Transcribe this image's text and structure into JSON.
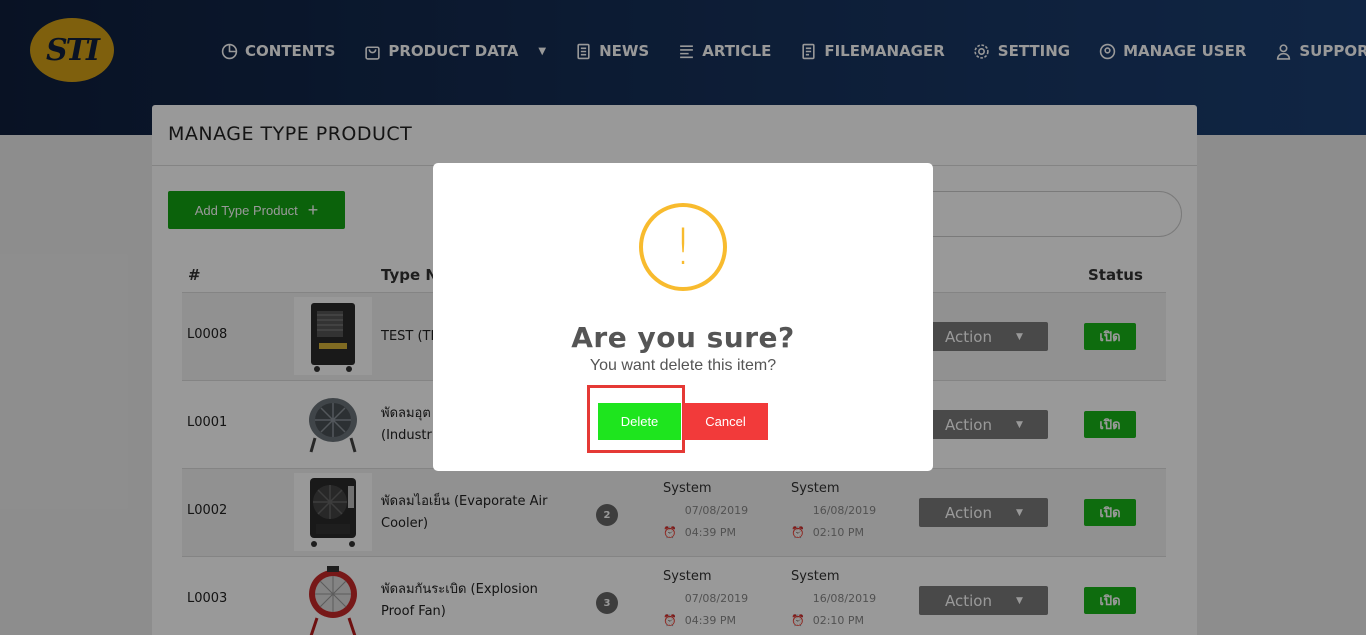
{
  "brand": {
    "logo_text": "STI"
  },
  "nav": [
    {
      "label": "CONTENTS",
      "icon": "pie-chart-icon"
    },
    {
      "label": "PRODUCT DATA",
      "icon": "bag-icon"
    },
    {
      "label": "NEWS",
      "icon": "newspaper-icon"
    },
    {
      "label": "ARTICLE",
      "icon": "text-lines-icon"
    },
    {
      "label": "FILEMANAGER",
      "icon": "document-icon"
    },
    {
      "label": "SETTING",
      "icon": "gear-icon"
    },
    {
      "label": "MANAGE USER",
      "icon": "user-circle-icon"
    },
    {
      "label": "SUPPORT",
      "icon": "person-icon"
    }
  ],
  "page": {
    "title": "MANAGE TYPE PRODUCT",
    "add_button": "Add Type Product",
    "add_icon": "+"
  },
  "table": {
    "headers": {
      "code": "#",
      "type_name": "Type N",
      "status": "Status"
    },
    "rows": [
      {
        "code": "L0008",
        "name": "TEST (TE",
        "count": "",
        "created_by": "",
        "created_at": "",
        "updated_by": "",
        "updated_at": "",
        "action": "Action",
        "status": "เปิด"
      },
      {
        "code": "L0001",
        "name": "พัดลมอุต\n(Industri",
        "count": "",
        "created_by": "",
        "created_at": "",
        "updated_by": "",
        "updated_at": "",
        "action": "Action",
        "status": "เปิด"
      },
      {
        "code": "L0002",
        "name": "พัดลมไอเย็น (Evaporate Air Cooler)",
        "count": "2",
        "created_by": "System",
        "created_at": "07/08/2019 04:39 PM",
        "updated_by": "System",
        "updated_at": "16/08/2019 02:10 PM",
        "action": "Action",
        "status": "เปิด"
      },
      {
        "code": "L0003",
        "name": "พัดลมกันระเบิด (Explosion Proof Fan)",
        "count": "3",
        "created_by": "System",
        "created_at": "07/08/2019 04:39 PM",
        "updated_by": "System",
        "updated_at": "16/08/2019 02:10 PM",
        "action": "Action",
        "status": "เปิด"
      }
    ]
  },
  "dialog": {
    "icon": "!",
    "title": "Are you sure?",
    "text": "You want delete this item?",
    "confirm_label": "Delete",
    "cancel_label": "Cancel"
  },
  "colors": {
    "header": "#17335e",
    "add_button": "#13a313",
    "status_on": "#18b418",
    "delete_button": "#1ee51e",
    "cancel_button": "#f23a3a",
    "warning": "#f8bb2e",
    "highlight": "#e53935"
  }
}
